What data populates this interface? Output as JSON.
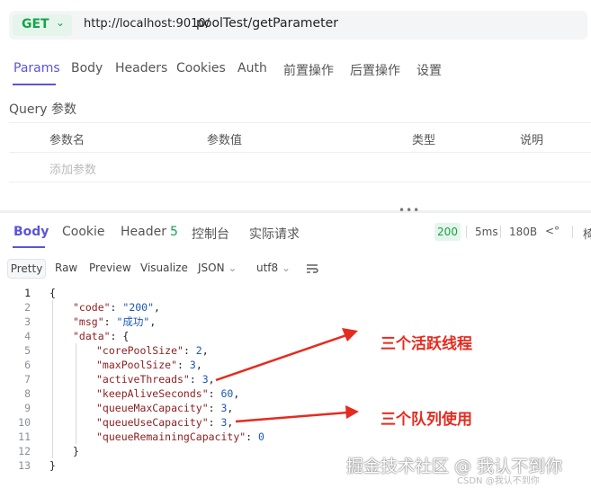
{
  "request": {
    "method": "GET",
    "url_base": "http://localhost:9010/",
    "url_path": "poolTest/getParameter",
    "tabs": [
      "Params",
      "Body",
      "Headers",
      "Cookies",
      "Auth",
      "前置操作",
      "后置操作",
      "设置"
    ],
    "active_tab": "Params",
    "query_title": "Query 参数",
    "query_columns": [
      "参数名",
      "参数值",
      "类型",
      "说明"
    ],
    "add_param_placeholder": "添加参数"
  },
  "response": {
    "tabs": [
      "Body",
      "Cookie",
      "Header",
      "控制台",
      "实际请求"
    ],
    "header_count": "5",
    "active_tab": "Body",
    "status": "200",
    "time": "5ms",
    "size": "180B",
    "cut_label": "椅",
    "format_tabs": [
      "Pretty",
      "Raw",
      "Preview",
      "Visualize"
    ],
    "active_format": "Pretty",
    "format_select": "JSON",
    "encoding_select": "utf8"
  },
  "code": {
    "line_numbers": [
      "1",
      "2",
      "3",
      "4",
      "5",
      "6",
      "7",
      "8",
      "9",
      "10",
      "11",
      "12",
      "13"
    ],
    "lines": [
      {
        "pre": "{"
      },
      {
        "key": "\"code\"",
        "mid": ": ",
        "val": "\"200\"",
        "post": ","
      },
      {
        "key": "\"msg\"",
        "mid": ": ",
        "val": "\"成功\"",
        "post": ","
      },
      {
        "key": "\"data\"",
        "mid": ": ",
        "val": "",
        "post": "{"
      },
      {
        "key": "\"corePoolSize\"",
        "mid": ": ",
        "val": "2",
        "post": ","
      },
      {
        "key": "\"maxPoolSize\"",
        "mid": ": ",
        "val": "3",
        "post": ","
      },
      {
        "key": "\"activeThreads\"",
        "mid": ": ",
        "val": "3",
        "post": ","
      },
      {
        "key": "\"keepAliveSeconds\"",
        "mid": ": ",
        "val": "60",
        "post": ","
      },
      {
        "key": "\"queueMaxCapacity\"",
        "mid": ": ",
        "val": "3",
        "post": ","
      },
      {
        "key": "\"queueUseCapacity\"",
        "mid": ": ",
        "val": "3",
        "post": ","
      },
      {
        "key": "\"queueRemainingCapacity\"",
        "mid": ": ",
        "val": "0",
        "post": ""
      },
      {
        "pre": "}"
      },
      {
        "pre": "}"
      }
    ]
  },
  "annotations": {
    "active_threads": "三个活跃线程",
    "queue_used": "三个队列使用",
    "color": "#e52b1f"
  },
  "watermark": {
    "main": "掘金技术社区 @ 我认不到你",
    "sub": "CSDN @我认不到你"
  },
  "colors": {
    "accent": "#5b55d6",
    "get_green": "#16a34a"
  }
}
